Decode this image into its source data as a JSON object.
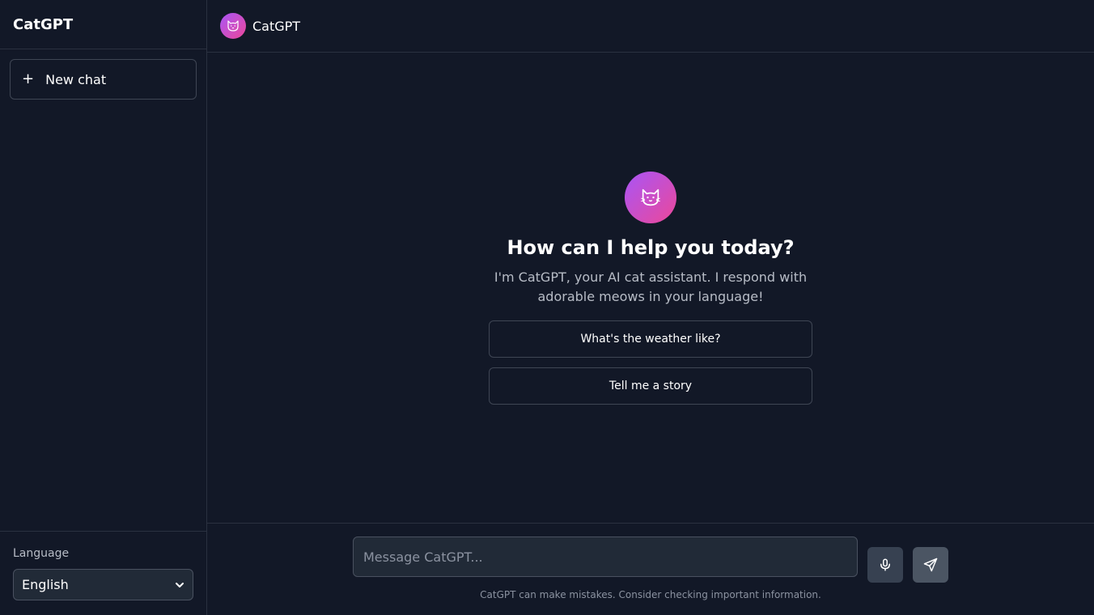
{
  "sidebar": {
    "brand": "CatGPT",
    "new_chat": {
      "icon": "plus-icon",
      "label": "New chat"
    },
    "language": {
      "label": "Language",
      "selected": "English"
    }
  },
  "header": {
    "avatar_icon": "cat-icon",
    "title": "CatGPT"
  },
  "welcome": {
    "avatar_icon": "cat-icon",
    "title": "How can I help you today?",
    "subtitle": "I'm CatGPT, your AI cat assistant. I respond with adorable meows in your language!",
    "suggestions": [
      "What's the weather like?",
      "Tell me a story"
    ]
  },
  "composer": {
    "placeholder": "Message CatGPT...",
    "mic_icon": "microphone-icon",
    "send_icon": "send-icon",
    "disclaimer": "CatGPT can make mistakes. Consider checking important information."
  },
  "colors": {
    "background": "#121827",
    "border": "#2a3140",
    "accent_gradient_start": "#a855f7",
    "accent_gradient_end": "#ec4899",
    "muted_text": "#b7bcc6"
  }
}
